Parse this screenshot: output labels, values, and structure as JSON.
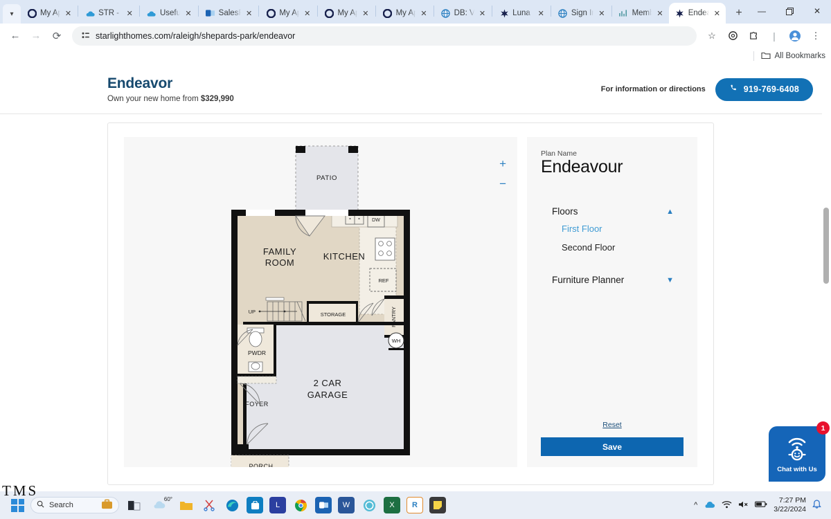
{
  "browser": {
    "tabs": [
      {
        "title": "My Ap",
        "icon": "circle-icon",
        "active": false
      },
      {
        "title": "STR - (",
        "icon": "cloud-icon",
        "active": false
      },
      {
        "title": "Useful",
        "icon": "cloud-icon",
        "active": false
      },
      {
        "title": "SalesF",
        "icon": "outlook-icon",
        "active": false
      },
      {
        "title": "My Ap",
        "icon": "circle-icon",
        "active": false
      },
      {
        "title": "My Ap",
        "icon": "circle-icon",
        "active": false
      },
      {
        "title": "My Ap",
        "icon": "circle-icon",
        "active": false
      },
      {
        "title": "DB: Vi",
        "icon": "globe-icon",
        "active": false
      },
      {
        "title": "Luna -",
        "icon": "star-icon",
        "active": false
      },
      {
        "title": "Sign In",
        "icon": "globe-icon",
        "active": false
      },
      {
        "title": "Memb",
        "icon": "chart-icon",
        "active": false
      },
      {
        "title": "Endea",
        "icon": "star-icon",
        "active": true
      }
    ],
    "new_tab_label": "+",
    "window_controls": {
      "minimize": "—",
      "maximize": "❐",
      "close": "✕"
    },
    "back_label": "←",
    "forward_label": "→",
    "reload_label": "⟳",
    "url": "starlighthomes.com/raleigh/shepards-park/endeavor",
    "star_label": "☆",
    "bookmarks_label": "All Bookmarks"
  },
  "site": {
    "title": "Endeavor",
    "subtitle_prefix": "Own your new home from ",
    "price": "$329,990",
    "info_text": "For information or directions",
    "phone": "919-769-6408"
  },
  "planviewer": {
    "zoom_in": "+",
    "zoom_out": "−",
    "rooms": [
      {
        "name": "PATIO"
      },
      {
        "name": "FAMILY ROOM"
      },
      {
        "name": "KITCHEN"
      },
      {
        "name": "DW"
      },
      {
        "name": "REF"
      },
      {
        "name": "PANTRY"
      },
      {
        "name": "UP"
      },
      {
        "name": "STORAGE"
      },
      {
        "name": "WH"
      },
      {
        "name": "PWDR"
      },
      {
        "name": "2 CAR GARAGE"
      },
      {
        "name": "FOYER"
      },
      {
        "name": "PORCH"
      }
    ],
    "labels": {
      "patio": "PATIO",
      "family_room_l1": "FAMILY",
      "family_room_l2": "ROOM",
      "kitchen": "KITCHEN",
      "dw": "DW",
      "ref": "REF",
      "pantry": "PANTRY",
      "up": "UP",
      "storage": "STORAGE",
      "wh": "WH",
      "pwdr": "PWDR",
      "garage_l1": "2 CAR",
      "garage_l2": "GARAGE",
      "foyer": "FOYER",
      "porch": "PORCH"
    }
  },
  "sidepanel": {
    "plan_name_label": "Plan Name",
    "plan_name": "Endeavour",
    "floors_label": "Floors",
    "floors_expanded": true,
    "floors": [
      {
        "label": "First Floor",
        "selected": true
      },
      {
        "label": "Second Floor",
        "selected": false
      }
    ],
    "furniture_label": "Furniture Planner",
    "furniture_expanded": false,
    "reset_label": "Reset",
    "save_label": "Save",
    "accent_color": "#3f9bd4",
    "save_bg": "#0d66b0"
  },
  "chat": {
    "label": "Chat with Us",
    "badge_count": "1",
    "bg": "#1565b8",
    "badge_bg": "#e8112d"
  },
  "taskbar": {
    "search_placeholder": "Search",
    "weather_temp": "60°",
    "time": "7:27 PM",
    "date": "3/22/2024",
    "apps": [
      "file-explorer-icon",
      "snip-icon",
      "edge-icon",
      "store-icon",
      "l-app-icon",
      "chrome-icon",
      "outlook-icon",
      "word-icon",
      "teams-icon",
      "excel-icon",
      "r-app-icon",
      "notes-icon"
    ]
  },
  "watermark": "TMS"
}
